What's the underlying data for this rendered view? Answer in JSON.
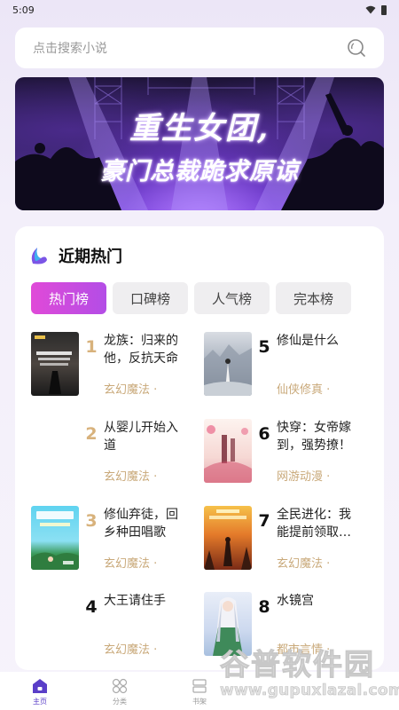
{
  "status": {
    "time": "5:09"
  },
  "search": {
    "placeholder": "点击搜索小说"
  },
  "banner": {
    "line1": "重生女团,",
    "line2": "豪门总裁跪求原谅"
  },
  "section": {
    "title": "近期热门"
  },
  "tabs": [
    "热门榜",
    "口碑榜",
    "人气榜",
    "完本榜"
  ],
  "books": [
    {
      "rank": "1",
      "title": "龙族：归来的他，反抗天命",
      "genre": "玄幻魔法 ·",
      "cover_label": "龙族：反抗天命"
    },
    {
      "rank": "2",
      "title": "从婴儿开始入道",
      "genre": "玄幻魔法 ·",
      "cover_label": ""
    },
    {
      "rank": "3",
      "title": "修仙弃徒，回乡种田唱歌",
      "genre": "玄幻魔法 ·",
      "cover_label": "修仙弃徒"
    },
    {
      "rank": "4",
      "title": "大王请住手",
      "genre": "玄幻魔法 ·",
      "cover_label": ""
    },
    {
      "rank": "5",
      "title": "修仙是什么",
      "genre": "仙侠修真 ·",
      "cover_label": ""
    },
    {
      "rank": "6",
      "title": "快穿：女帝嫁到，强势撩！",
      "genre": "网游动漫 ·",
      "cover_label": ""
    },
    {
      "rank": "7",
      "title": "全民进化：我能提前领取…",
      "genre": "玄幻魔法 ·",
      "cover_label": ""
    },
    {
      "rank": "8",
      "title": "水镜宫",
      "genre": "都市言情 ·",
      "cover_label": ""
    }
  ],
  "nav": [
    {
      "label": "主页",
      "icon": "home-icon"
    },
    {
      "label": "分类",
      "icon": "category-icon"
    },
    {
      "label": "书架",
      "icon": "bookshelf-icon"
    }
  ],
  "watermark": {
    "main": "谷普软件园",
    "url": "www.gupuxlazal.com"
  },
  "colors": {
    "accent": "#b34de6",
    "rank_gold": "#d8b27c",
    "genre": "#c9a97a"
  }
}
